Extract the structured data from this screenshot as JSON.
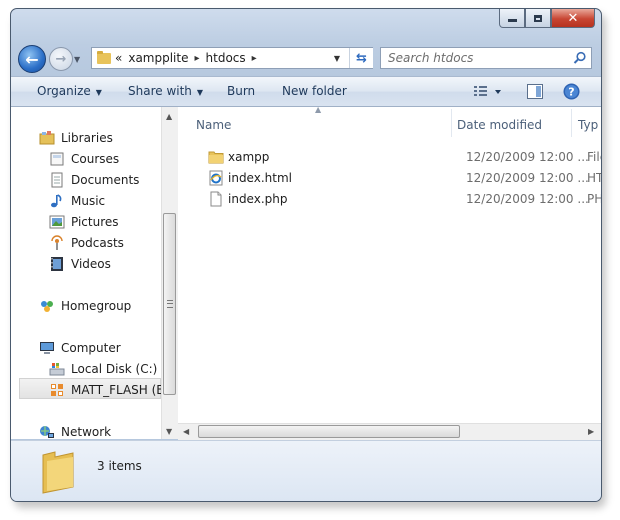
{
  "window": {
    "controls": {
      "minimize_icon": "minimize-icon",
      "maximize_icon": "maximize-icon",
      "close_icon": "close-icon"
    }
  },
  "address": {
    "crumbs": [
      "xampplite",
      "htdocs"
    ],
    "overflow": "«",
    "separator": "▸"
  },
  "search": {
    "placeholder": "Search htdocs"
  },
  "toolbar": {
    "organize": "Organize",
    "share_with": "Share with",
    "burn": "Burn",
    "new_folder": "New folder"
  },
  "sidebar": {
    "libraries": "Libraries",
    "library_items": [
      "Courses",
      "Documents",
      "Music",
      "Pictures",
      "Podcasts",
      "Videos"
    ],
    "homegroup": "Homegroup",
    "computer": "Computer",
    "computer_items": [
      "Local Disk (C:)",
      "MATT_FLASH (E:"
    ],
    "network": "Network"
  },
  "columns": {
    "name": "Name",
    "date_modified": "Date modified",
    "type": "Typ"
  },
  "files": [
    {
      "name": "xampp",
      "date": "12/20/2009 12:00 ...",
      "type": "File",
      "icon": "folder-icon"
    },
    {
      "name": "index.html",
      "date": "12/20/2009 12:00 ...",
      "type": "HTI",
      "icon": "ie-html-icon"
    },
    {
      "name": "index.php",
      "date": "12/20/2009 12:00 ...",
      "type": "PHI",
      "icon": "blank-file-icon"
    }
  ],
  "details": {
    "count": "3 items"
  },
  "colors": {
    "selection": "#e3e3e3",
    "chrome": "#bccde2",
    "link_text": "#1e395b"
  }
}
